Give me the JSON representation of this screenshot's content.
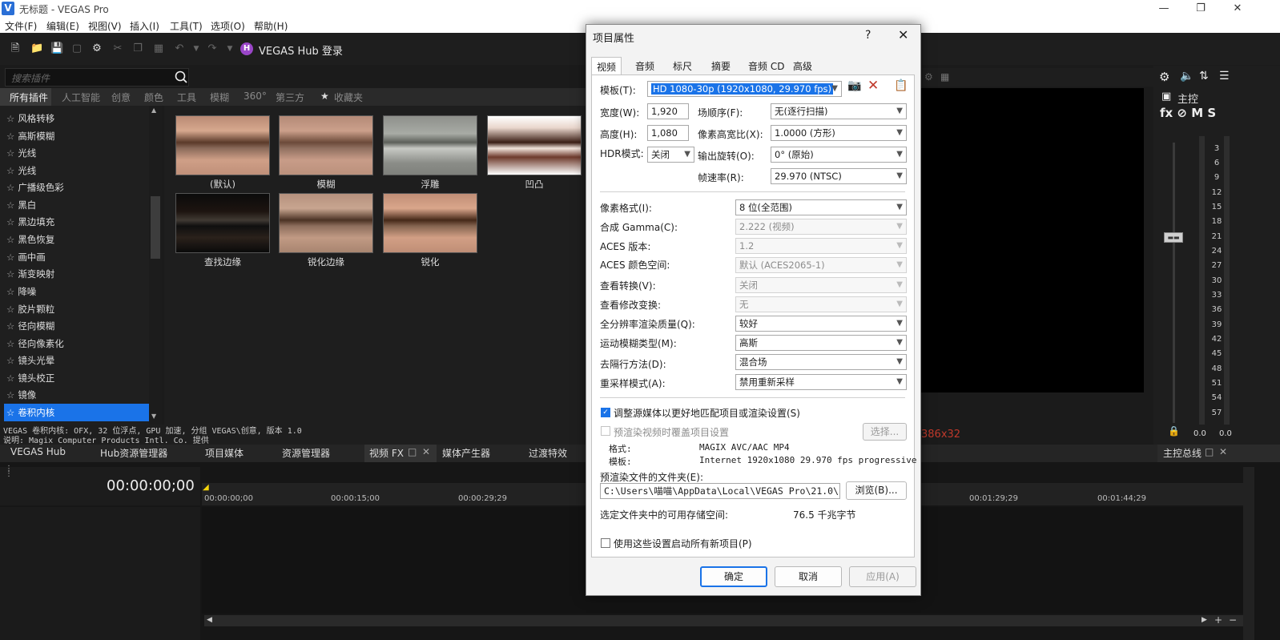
{
  "window": {
    "title": "无标题 - VEGAS Pro",
    "logo": "V"
  },
  "menu": [
    "文件(F)",
    "编辑(E)",
    "视图(V)",
    "插入(I)",
    "工具(T)",
    "选项(O)",
    "帮助(H)"
  ],
  "toolbar": {
    "hub_login": "VEGAS Hub 登录",
    "hub_logo": "H"
  },
  "plugins": {
    "search_placeholder": "搜索插件",
    "tabs": [
      "所有插件",
      "人工智能",
      "创意",
      "颜色",
      "工具",
      "模糊",
      "360°",
      "第三方",
      "收藏夹"
    ],
    "items": [
      "风格转移",
      "高斯模糊",
      "光线",
      "光线",
      "广播级色彩",
      "黑白",
      "黑边填充",
      "黑色恢复",
      "画中画",
      "渐变映射",
      "降噪",
      "胶片颗粒",
      "径向模糊",
      "径向像素化",
      "镜头光晕",
      "镜头校正",
      "镜像",
      "卷积内核"
    ],
    "selected": "卷积内核",
    "presets": [
      "(默认)",
      "模糊",
      "浮雕",
      "凹凸",
      "查找边缘",
      "锐化边缘",
      "锐化"
    ],
    "info1": "VEGAS 卷积内核: OFX, 32 位浮点, GPU 加速, 分组 VEGAS\\创意, 版本 1.0",
    "info2": "说明: Magix Computer Products Intl. Co. 提供"
  },
  "bottom_tabs": [
    "VEGAS Hub",
    "Hub资源管理器",
    "项目媒体",
    "资源管理器",
    "视频 FX",
    "媒体产生器",
    "过渡特效"
  ],
  "timeline": {
    "timecode": "00:00:00;00",
    "ruler": [
      "00:00:00;00",
      "00:00:15;00",
      "00:00:29;29",
      "00:01:29;29",
      "00:01:44;29"
    ]
  },
  "preview": {
    "info": "386x32"
  },
  "master": {
    "label": "主控",
    "fx_icons": "fx ⊘ M S",
    "bus_label": "主控总线",
    "scale": [
      "3",
      "6",
      "9",
      "12",
      "15",
      "18",
      "21",
      "24",
      "27",
      "30",
      "33",
      "36",
      "39",
      "42",
      "45",
      "48",
      "51",
      "54",
      "57"
    ],
    "level_l": "0.0",
    "level_r": "0.0"
  },
  "dialog": {
    "title": "项目属性",
    "help": "?",
    "tabs": [
      "视频",
      "音频",
      "标尺",
      "摘要",
      "音频 CD",
      "高级"
    ],
    "template_label": "模板(T):",
    "template_value": "HD 1080-30p (1920x1080, 29.970 fps)",
    "width_label": "宽度(W):",
    "width_value": "1,920",
    "height_label": "高度(H):",
    "height_value": "1,080",
    "hdr_label": "HDR模式:",
    "hdr_value": "关闭",
    "field_order_label": "场顺序(F):",
    "field_order_value": "无(逐行扫描)",
    "pixel_aspect_label": "像素高宽比(X):",
    "pixel_aspect_value": "1.0000 (方形)",
    "rotation_label": "输出旋转(O):",
    "rotation_value": "0° (原始)",
    "frame_rate_label": "帧速率(R):",
    "frame_rate_value": "29.970 (NTSC)",
    "pixel_format_label": "像素格式(I):",
    "pixel_format_value": "8 位(全范围)",
    "gamma_label": "合成 Gamma(C):",
    "gamma_value": "2.222 (视频)",
    "aces_version_label": "ACES 版本:",
    "aces_version_value": "1.2",
    "aces_space_label": "ACES 颜色空间:",
    "aces_space_value": "默认 (ACES2065-1)",
    "view_transform_label": "查看转换(V):",
    "view_transform_value": "关闭",
    "look_modify_label": "查看修改变换:",
    "look_modify_value": "无",
    "render_quality_label": "全分辨率渲染质量(Q):",
    "render_quality_value": "较好",
    "motion_blur_label": "运动模糊类型(M):",
    "motion_blur_value": "高斯",
    "deinterlace_label": "去隔行方法(D):",
    "deinterlace_value": "混合场",
    "resample_label": "重采样模式(A):",
    "resample_value": "禁用重新采样",
    "adjust_source_label": "调整源媒体以更好地匹配项目或渲染设置(S)",
    "prerender_label": "预渲染视频时覆盖项目设置",
    "select_button": "选择...",
    "format_label": "格式:",
    "format_value": "MAGIX AVC/AAC MP4",
    "template2_label": "模板:",
    "template2_value": "Internet 1920x1080 29.970 fps progressive",
    "prerender_folder_label": "预渲染文件的文件夹(E):",
    "folder_value": "C:\\Users\\喵喵\\AppData\\Local\\VEGAS Pro\\21.0\\",
    "browse_button": "浏览(B)...",
    "free_space_label": "选定文件夹中的可用存储空间:",
    "free_space_value": "76.5 千兆字节",
    "use_settings_label": "使用这些设置启动所有新项目(P)",
    "ok": "确定",
    "cancel": "取消",
    "apply": "应用(A)"
  }
}
